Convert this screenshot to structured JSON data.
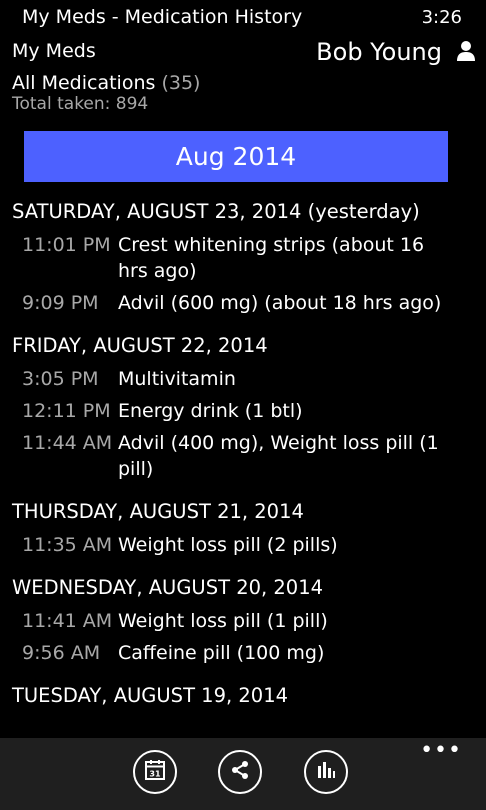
{
  "status_bar": {
    "app_title": "My Meds - Medication History",
    "clock": "3:26"
  },
  "header": {
    "section_title": "My Meds",
    "user_name": "Bob Young",
    "all_meds_label": "All Medications",
    "all_meds_count": "(35)",
    "total_taken": "Total taken: 894"
  },
  "month_banner": "Aug 2014",
  "days": [
    {
      "label": "SATURDAY, AUGUST 23, 2014 (yesterday)",
      "entries": [
        {
          "time": "11:01 PM",
          "text": "Crest whitening strips (about 16 hrs ago)"
        },
        {
          "time": "9:09 PM",
          "text": "Advil (600 mg) (about 18 hrs ago)"
        }
      ]
    },
    {
      "label": "FRIDAY, AUGUST 22, 2014",
      "entries": [
        {
          "time": "3:05 PM",
          "text": "Multivitamin"
        },
        {
          "time": "12:11 PM",
          "text": "Energy drink (1 btl)"
        },
        {
          "time": "11:44 AM",
          "text": "Advil (400 mg), Weight loss pill (1 pill)"
        }
      ]
    },
    {
      "label": "THURSDAY, AUGUST 21, 2014",
      "entries": [
        {
          "time": "11:35 AM",
          "text": "Weight loss pill (2 pills)"
        }
      ]
    },
    {
      "label": "WEDNESDAY, AUGUST 20, 2014",
      "entries": [
        {
          "time": "11:41 AM",
          "text": "Weight loss pill (1 pill)"
        },
        {
          "time": "9:56 AM",
          "text": "Caffeine pill (100 mg)"
        }
      ]
    },
    {
      "label": "TUESDAY, AUGUST 19, 2014",
      "entries": []
    }
  ],
  "app_bar": {
    "calendar_day": "31",
    "buttons": [
      "calendar-icon",
      "share-icon",
      "stats-icon"
    ],
    "more_icon": "ellipsis-icon"
  },
  "colors": {
    "accent": "#4d61ff",
    "secondary_text": "#a8a8a8",
    "app_bar": "#1f1f1f"
  }
}
